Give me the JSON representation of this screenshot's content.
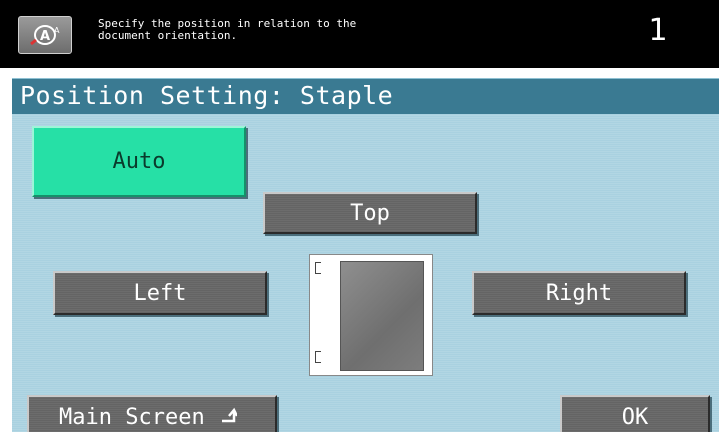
{
  "header": {
    "message": "Specify the position in relation to the\ndocument orientation.",
    "count": "1",
    "help_icon": "help-zoom-icon"
  },
  "title": "Position Setting: Staple",
  "options": {
    "auto": "Auto",
    "top": "Top",
    "left": "Left",
    "right": "Right",
    "selected": "Auto"
  },
  "footer": {
    "main_screen": "Main Screen",
    "ok": "OK"
  },
  "colors": {
    "selected": "#26e0a6",
    "panel": "#a9d1e0",
    "title_bar": "#3a7a92",
    "button": "#6c6c6c"
  }
}
